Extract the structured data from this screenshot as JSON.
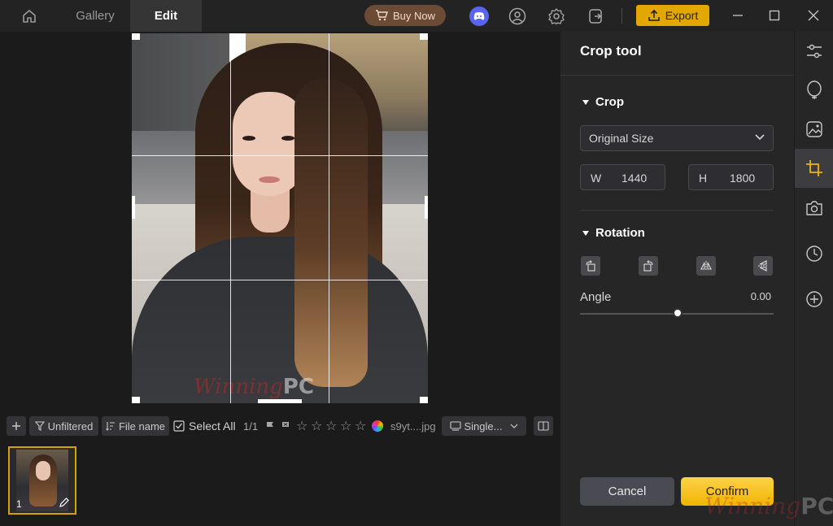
{
  "topbar": {
    "tabs": [
      {
        "label": "Gallery"
      },
      {
        "label": "Edit"
      }
    ],
    "buy_label": "Buy Now",
    "export_label": "Export"
  },
  "filmstrip": {
    "filter_label": "Unfiltered",
    "sort_label": "File name",
    "select_all_label": "Select All",
    "selection_count": "1/1",
    "file_name": "s9yt....jpg",
    "view_mode": "Single...",
    "rating": 0,
    "thumbnail_index": "1"
  },
  "watermark": {
    "script": "Winning",
    "bold": "PC"
  },
  "panel": {
    "title": "Crop tool",
    "crop_section": "Crop",
    "aspect_select": "Original Size",
    "width_label": "W",
    "width_value": "1440",
    "height_label": "H",
    "height_value": "1800",
    "rotation_section": "Rotation",
    "angle_label": "Angle",
    "angle_value": "0.00",
    "cancel_label": "Cancel",
    "confirm_label": "Confirm"
  },
  "colors": {
    "accent": "#e3a800",
    "confirm": "#f5c21a",
    "discord": "#5865f2"
  },
  "rail_icons": [
    "adjust-sliders-icon",
    "retouch-bulb-icon",
    "image-effects-icon",
    "crop-icon",
    "camera-icon",
    "history-clock-icon",
    "add-plus-icon"
  ]
}
